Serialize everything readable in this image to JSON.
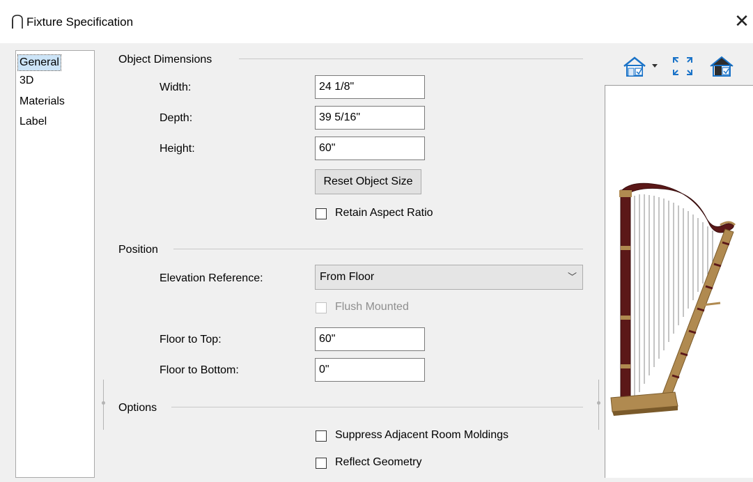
{
  "window": {
    "title": "Fixture Specification"
  },
  "nav": {
    "items": [
      "General",
      "3D",
      "Materials",
      "Label"
    ]
  },
  "sections": {
    "object_dimensions": {
      "title": "Object Dimensions",
      "width_label": "Width:",
      "width_value": "24 1/8\"",
      "depth_label": "Depth:",
      "depth_value": "39 5/16\"",
      "height_label": "Height:",
      "height_value": "60\"",
      "reset_button": "Reset Object Size",
      "retain_aspect_label": "Retain Aspect Ratio"
    },
    "position": {
      "title": "Position",
      "elevation_label": "Elevation Reference:",
      "elevation_value": "From Floor",
      "flush_label": "Flush Mounted",
      "floor_top_label": "Floor to Top:",
      "floor_top_value": "60\"",
      "floor_bottom_label": "Floor to Bottom:",
      "floor_bottom_value": "0\""
    },
    "options": {
      "title": "Options",
      "suppress_label": "Suppress Adjacent Room Moldings",
      "reflect_label": "Reflect Geometry"
    }
  },
  "toolbar": {
    "icons": [
      "view-type-dropdown-icon",
      "fit-to-window-icon",
      "preview-options-icon"
    ]
  },
  "colors": {
    "accent": "#1a73c8",
    "nav_selected": "#cce4f7",
    "harp_wood": "#5b1818",
    "harp_gold": "#b08a50"
  }
}
